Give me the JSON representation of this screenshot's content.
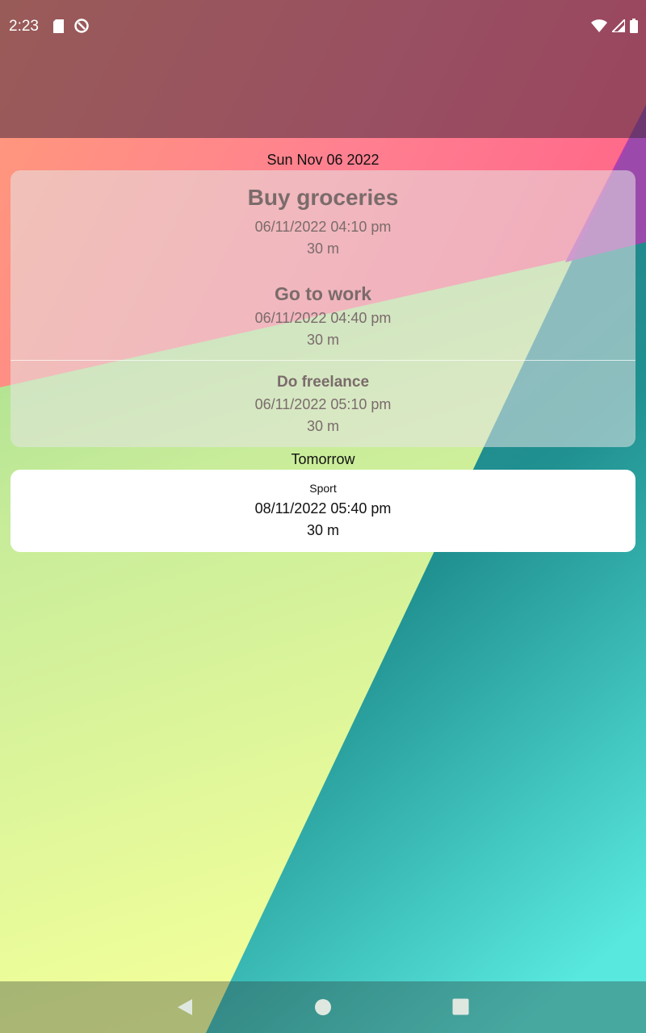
{
  "status_bar": {
    "time": "2:23"
  },
  "sections": [
    {
      "header": "Sun Nov 06 2022",
      "tasks": [
        {
          "title": "Buy groceries",
          "datetime": "06/11/2022 04:10 pm",
          "duration": "30 m"
        },
        {
          "title": "Go to work",
          "datetime": "06/11/2022 04:40 pm",
          "duration": "30 m"
        },
        {
          "title": "Do freelance",
          "datetime": "06/11/2022 05:10 pm",
          "duration": "30 m"
        }
      ]
    },
    {
      "header": "Tomorrow",
      "tasks": [
        {
          "title": "Sport",
          "datetime": "08/11/2022 05:40 pm",
          "duration": "30 m"
        }
      ]
    }
  ],
  "icons": [
    "sd-card-icon",
    "sync-icon",
    "wifi-icon",
    "signal-icon",
    "battery-icon",
    "back-icon",
    "home-icon",
    "recents-icon"
  ]
}
